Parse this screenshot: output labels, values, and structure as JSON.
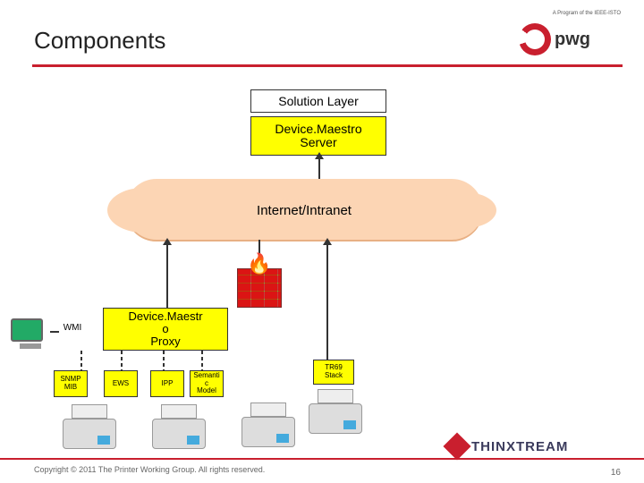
{
  "title": "Components",
  "logo": {
    "text": "pwg",
    "tagline": "A Program of the IEEE-ISTO"
  },
  "boxes": {
    "solution": "Solution Layer",
    "server_l1": "Device.Maestro",
    "server_l2": "Server",
    "cloud": "Internet/Intranet",
    "proxy_l1": "Device.Maestr",
    "proxy_l2": "o",
    "proxy_l3": "Proxy",
    "wmi": "WMI",
    "snmp_l1": "SNMP",
    "snmp_l2": "MIB",
    "ews": "EWS",
    "ipp": "IPP",
    "sem_l1": "Semanti",
    "sem_l2": "c",
    "sem_l3": "Model",
    "tr_l1": "TR69",
    "tr_l2": "Stack"
  },
  "footer": {
    "copyright": "Copyright © 2011 The Printer Working Group. All rights reserved.",
    "page": "16",
    "brand": "THINXTREAM"
  },
  "colors": {
    "accent": "#c91f2e",
    "highlight": "#ffff00",
    "cloud": "#fcd5b4"
  }
}
